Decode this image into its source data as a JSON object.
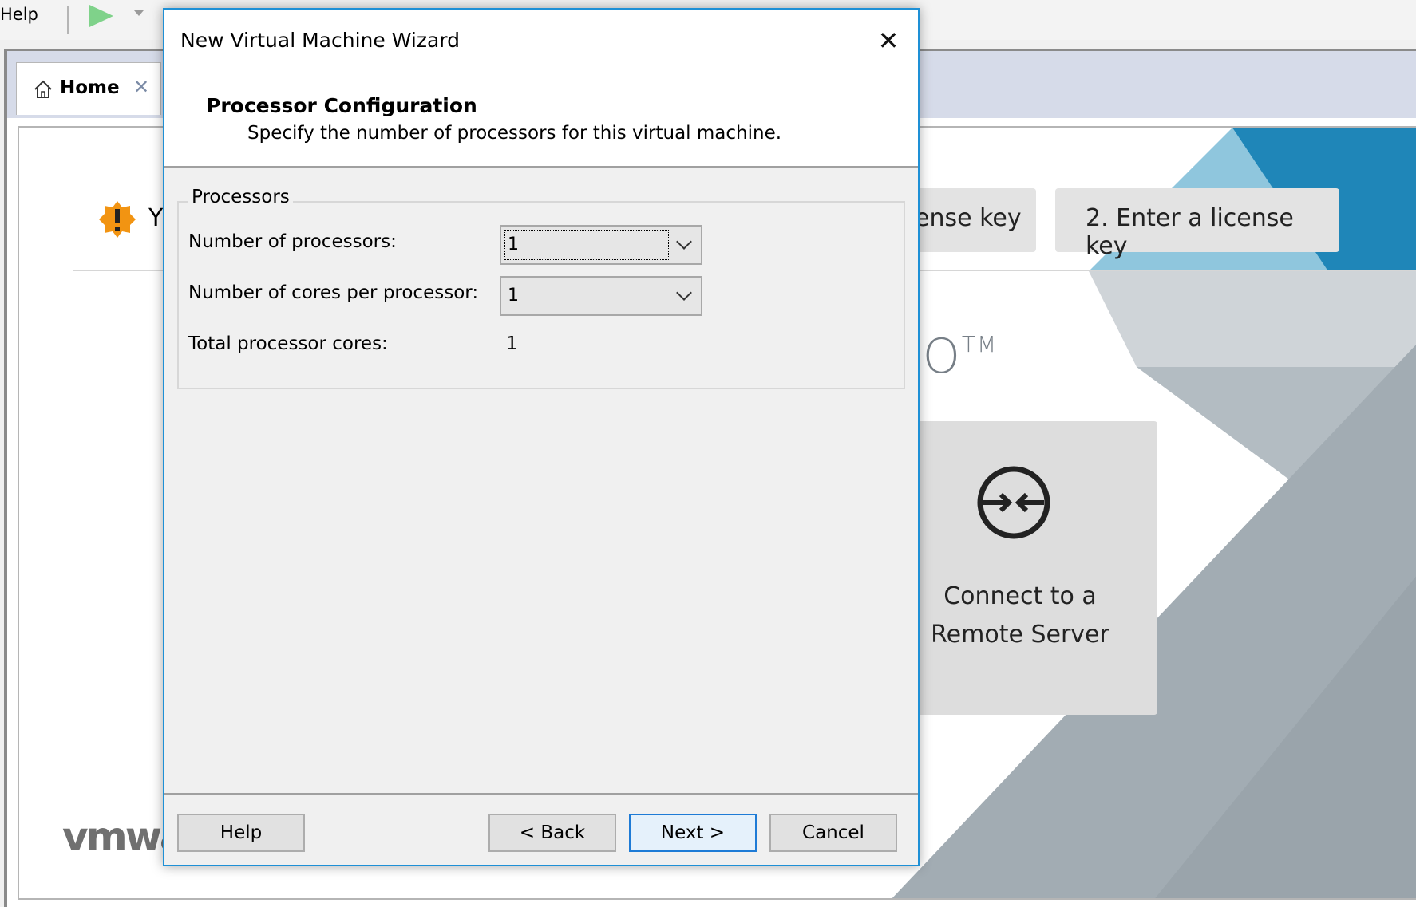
{
  "menubar": {
    "help_label": "Help"
  },
  "tabs": {
    "home_label": "Home",
    "close_glyph": "✕"
  },
  "home": {
    "warning_text": "Y",
    "license_button_1": "ense key",
    "license_button_2": "2. Enter a license key",
    "product_text": "RO",
    "trademark": "TM",
    "remote_tile": {
      "line1": "Connect to a",
      "line2": "Remote Server"
    },
    "logo_text": "vmwa"
  },
  "dialog": {
    "title": "New Virtual Machine Wizard",
    "close_glyph": "✕",
    "header_title": "Processor Configuration",
    "header_subtitle": "Specify the number of processors for this virtual machine.",
    "group_label": "Processors",
    "fields": {
      "num_processors_label": "Number of processors:",
      "num_processors_value": "1",
      "cores_per_processor_label": "Number of cores per processor:",
      "cores_per_processor_value": "1",
      "total_cores_label": "Total processor cores:",
      "total_cores_value": "1"
    },
    "buttons": {
      "help": "Help",
      "back": "< Back",
      "next": "Next >",
      "cancel": "Cancel"
    }
  },
  "colors": {
    "accent": "#1e90d6",
    "warning": "#f29412",
    "tile_bg": "#dddddd",
    "decor_blue": "#1f86b8"
  },
  "icons": [
    "play-icon",
    "home-icon",
    "close-icon",
    "warning-icon",
    "remote-server-icon",
    "chevron-down-icon"
  ]
}
